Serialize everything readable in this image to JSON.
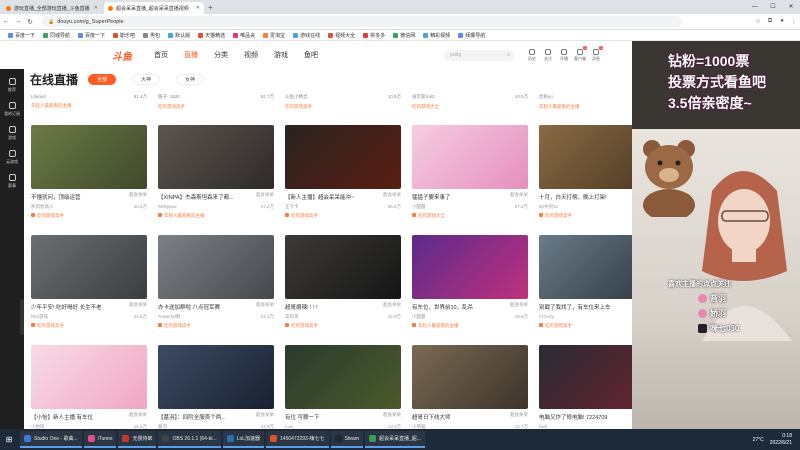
{
  "browser": {
    "tabs": [
      {
        "label": "游玩直播_全部游玩直播_斗鱼直播",
        "active": false
      },
      {
        "label": "超会呆呆直播_超会呆呆直播视频",
        "active": true
      }
    ],
    "url": "douyu.com/g_SuperPeople",
    "bookmarks": [
      "百度一下",
      "同城导航",
      "百度一下",
      "斯乐吧",
      "男包",
      "默认版",
      "天猫精选",
      "唯品会",
      "爱淘宝",
      "游戏在线",
      "视频大全",
      "拼多多",
      "微信网",
      "精彩视频",
      "拜娜导航"
    ]
  },
  "douyu": {
    "logo": "斗鱼",
    "nav": [
      "首页",
      "直播",
      "分类",
      "视频",
      "游戏",
      "鱼吧"
    ],
    "search_placeholder": "pubg",
    "header_icons": [
      {
        "label": "历史",
        "badge": ""
      },
      {
        "label": "关注",
        "badge": ""
      },
      {
        "label": "开播",
        "badge": ""
      },
      {
        "label": "客户端",
        "badge": "1"
      },
      {
        "label": "消息",
        "badge": "1"
      }
    ]
  },
  "sidebar": [
    {
      "label": "推荐"
    },
    {
      "label": "我的订阅"
    },
    {
      "label": "游戏"
    },
    {
      "label": "云游戏"
    },
    {
      "label": "赛事"
    }
  ],
  "page": {
    "title": "在线直播",
    "filters": [
      {
        "label": "全部",
        "active": true
      },
      {
        "label": "大神",
        "active": false
      },
      {
        "label": "女神",
        "active": false
      }
    ]
  },
  "prev_row": [
    {
      "user": "Lifeand",
      "hot": "81.4万",
      "tag": "年轻人最爱看的主播"
    },
    {
      "user": "狼子· 1520",
      "hot": "52.7万",
      "tag": "吃鸡游戏高手"
    },
    {
      "user": "斗鱼小精灵",
      "hot": "10.5万",
      "tag": "吃鸡游戏高手"
    },
    {
      "user": "张可爱Sol2",
      "hot": "10.5万",
      "tag": "吃鸡游戏大全"
    },
    {
      "user": "优民yu",
      "hot": "48.5万",
      "tag": "年轻人最爱看的主播"
    }
  ],
  "cards": [
    {
      "title": "不懂就问，顶级运营",
      "category": "超会呆呆",
      "user": "秋风愁煞人",
      "hot": "40.5万",
      "tag": "吃鸡游戏高手",
      "colors": [
        "#6d7a45",
        "#3e4a2b"
      ]
    },
    {
      "title": "【XINPA】杰森斯坦森来了都...",
      "category": "超会呆呆",
      "user": "XINtypou",
      "hot": "37.2万",
      "tag": "年轻人最爱看的主播",
      "colors": [
        "#5c5550",
        "#2e2a28"
      ]
    },
    {
      "title": "【新人主播】超会呆呆能冲~",
      "category": "超会呆呆",
      "user": "王卡卡",
      "hot": "36.6万",
      "tag": "吃鸡游戏高手",
      "colors": [
        "#2a2320",
        "#5a1d12"
      ]
    },
    {
      "title": "猛猛子要来事了",
      "category": "超会呆呆",
      "user": "小甜甜",
      "hot": "27.2万",
      "tag": "吃鸡游戏大全",
      "colors": [
        "#f6cde0",
        "#e58fbf"
      ]
    },
    {
      "title": "十月，白天打榜，晚上打架!",
      "category": "超会呆呆",
      "user": "Bo牛奶11",
      "hot": "25.4万",
      "tag": "吃鸡游戏高手",
      "colors": [
        "#8a6a45",
        "#4c3a22"
      ]
    },
    {
      "title": "少年平安! 吃好喝好 长生不老",
      "category": "超会呆呆",
      "user": "Dk0游戏",
      "hot": "24.6万",
      "tag": "吃鸡游戏高手",
      "colors": [
        "#6b6f72",
        "#3b3e40"
      ]
    },
    {
      "title": "办卡送加群啦 八点冠军赛",
      "category": "超会呆呆",
      "user": "Powerful明",
      "hot": "24.4万",
      "tag": "吃鸡游戏高手",
      "colors": [
        "#7d8085",
        "#45484c"
      ]
    },
    {
      "title": "超哥摘辣! ! ! !",
      "category": "超会呆呆",
      "user": "菜鸡哥",
      "hot": "22.9万",
      "tag": "吃鸡游戏高手",
      "colors": [
        "#3c3a38",
        "#151515"
      ]
    },
    {
      "title": "有东位，世界前10，乱杀",
      "category": "超会呆呆",
      "user": "小甜甜",
      "hot": "18.6万",
      "tag": "年轻人最爱看的主播",
      "colors": [
        "#5a2b8a",
        "#c0307e"
      ]
    },
    {
      "title": "别戳了我找了，有车位来上车",
      "category": "超会呆呆",
      "user": "Fzzerry",
      "hot": "16.9万",
      "tag": "吃鸡游戏高手",
      "colors": [
        "#6a7a86",
        "#2e3a44"
      ]
    },
    {
      "title": "【小怡】新人主播 有车位",
      "category": "超会呆呆",
      "user": "小怡呀",
      "hot": "15.4万",
      "tag": "年轻人最爱看的主播",
      "colors": [
        "#f8dbe6",
        "#f0a6c2"
      ]
    },
    {
      "title": "【墓羽】：四阶全服首个两...",
      "category": "超会呆呆",
      "user": "墓羽",
      "hot": "14.8万",
      "tag": "吃鸡游戏高手",
      "colors": [
        "#3d4a63",
        "#1a2230"
      ]
    },
    {
      "title": "有位 可颤一下",
      "category": "超会呆呆",
      "user": "Luvi",
      "hot": "13.1万",
      "tag": "吃鸡游戏高手",
      "colors": [
        "#2b3a2e",
        "#4a5a2a"
      ]
    },
    {
      "title": "超哥日下线大师",
      "category": "超会呆呆",
      "user": "小熊猫",
      "hot": "12.7万",
      "tag": "吃鸡游戏高手",
      "colors": [
        "#7a6a55",
        "#3d332a"
      ]
    },
    {
      "title": "电脑又炸了修电脑! 7224709",
      "category": "超会呆呆",
      "user": "hwk",
      "hot": "11.8万",
      "tag": "吃鸡游戏高手",
      "colors": [
        "#2a2c34",
        "#6a2230"
      ]
    }
  ],
  "overlay": {
    "lines": [
      "钻粉=1000票",
      "投票方式看鱼吧",
      "3.5倍亲密度~"
    ],
    "follow_text": "喜欢主播的点点关注",
    "names": [
      "音羽",
      "娇羽",
      "咪七030"
    ]
  },
  "taskbar": {
    "items": [
      {
        "label": "Studio One - 歌曲...",
        "color": "#3a7bd5"
      },
      {
        "label": "iTunes",
        "color": "#e24c8a"
      },
      {
        "label": "无畏侍郎",
        "color": "#c0392b"
      },
      {
        "label": "OBS 26.1.1 (64-bi...",
        "color": "#444"
      },
      {
        "label": "LoL加速器",
        "color": "#2a6fb0"
      },
      {
        "label": "1450472293-嗨七七",
        "color": "#d8552a"
      },
      {
        "label": "Steam",
        "color": "#1b2838"
      },
      {
        "label": "超会呆呆直播_超...",
        "color": "#3a9d50"
      }
    ],
    "weather": "27°C",
    "time": "0:18",
    "date": "2022/6/21"
  }
}
